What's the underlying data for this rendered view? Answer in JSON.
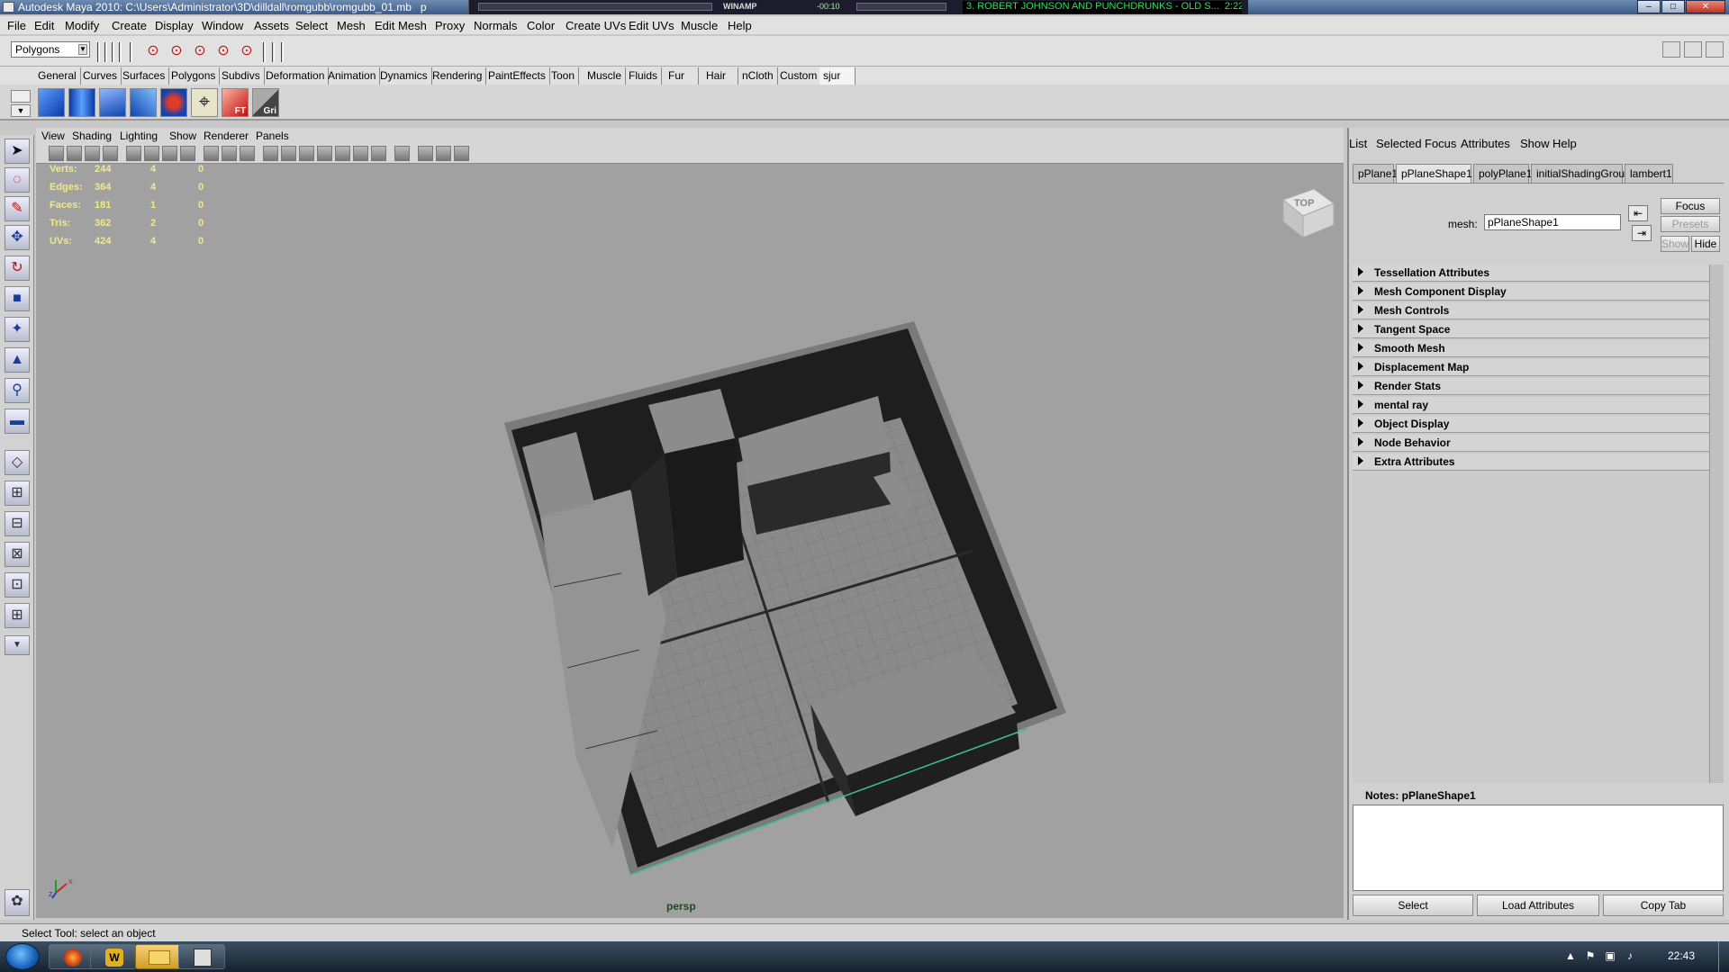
{
  "window": {
    "title": "Autodesk Maya 2010: C:\\Users\\Administrator\\3D\\dilldall\\romgubb\\romgubb_01.mb",
    "title_suffix": "p",
    "controls": [
      "minimize-icon",
      "maximize-icon",
      "close-icon"
    ]
  },
  "winamp": {
    "label": "WINAMP",
    "time": "-00:10",
    "song": "3. ROBERT JOHNSON AND PUNCHDRUNKS - OLD S...",
    "song_time": "2:22"
  },
  "menus": [
    "File",
    "Edit",
    "Modify",
    "Create",
    "Display",
    "Window",
    "Assets",
    "Select",
    "Mesh",
    "Edit Mesh",
    "Proxy",
    "Normals",
    "Color",
    "Create UVs",
    "Edit UVs",
    "Muscle",
    "Help"
  ],
  "status_line": {
    "mode": "Polygons"
  },
  "shelf_tabs": [
    "General",
    "Curves",
    "Surfaces",
    "Polygons",
    "Subdivs",
    "Deformation",
    "Animation",
    "Dynamics",
    "Rendering",
    "PaintEffects",
    "Toon",
    "Muscle",
    "Fluids",
    "Fur",
    "Hair",
    "nCloth",
    "Custom",
    "sjur"
  ],
  "shelf_active": "sjur",
  "shelf_icons": [
    "poly-cube-icon",
    "poly-cylinder-icon",
    "poly-plane-icon",
    "extrude-icon",
    "combine-icon",
    "snap-icon",
    "ft-icon",
    "grid-icon"
  ],
  "shelf_text": {
    "ft": "FT",
    "grid": "Gri"
  },
  "viewport": {
    "menus": [
      "View",
      "Shading",
      "Lighting",
      "Show",
      "Renderer",
      "Panels"
    ],
    "camera": "persp",
    "viewcube_label": "TOP",
    "hud": [
      {
        "label": "Verts:",
        "v1": "244",
        "v2": "4",
        "v3": "0"
      },
      {
        "label": "Edges:",
        "v1": "364",
        "v2": "4",
        "v3": "0"
      },
      {
        "label": "Faces:",
        "v1": "181",
        "v2": "1",
        "v3": "0"
      },
      {
        "label": "Tris:",
        "v1": "362",
        "v2": "2",
        "v3": "0"
      },
      {
        "label": "UVs:",
        "v1": "424",
        "v2": "4",
        "v3": "0"
      }
    ],
    "axis_labels": {
      "x": "x",
      "z": "z"
    }
  },
  "attribute_editor": {
    "menus": [
      "List",
      "Selected",
      "Focus",
      "Attributes",
      "Show",
      "Help"
    ],
    "tabs": [
      "pPlane1",
      "pPlaneShape1",
      "polyPlane1",
      "initialShadingGroup",
      "lambert1"
    ],
    "active_tab": "pPlaneShape1",
    "mesh_label": "mesh:",
    "mesh_value": "pPlaneShape1",
    "buttons": {
      "focus": "Focus",
      "presets": "Presets",
      "show": "Show",
      "hide": "Hide"
    },
    "sections": [
      "Tessellation Attributes",
      "Mesh Component Display",
      "Mesh Controls",
      "Tangent Space",
      "Smooth Mesh",
      "Displacement Map",
      "Render Stats",
      "mental ray",
      "Object Display",
      "Node Behavior",
      "Extra Attributes"
    ],
    "notes_title": "Notes:  pPlaneShape1",
    "bottom_buttons": [
      "Select",
      "Load Attributes",
      "Copy Tab"
    ]
  },
  "help_line": "Select Tool: select an object",
  "taskbar": {
    "clock": "22:43",
    "buttons": [
      "firefox-icon",
      "winamp-icon",
      "explorer-folder-icon",
      "maya-icon"
    ]
  }
}
